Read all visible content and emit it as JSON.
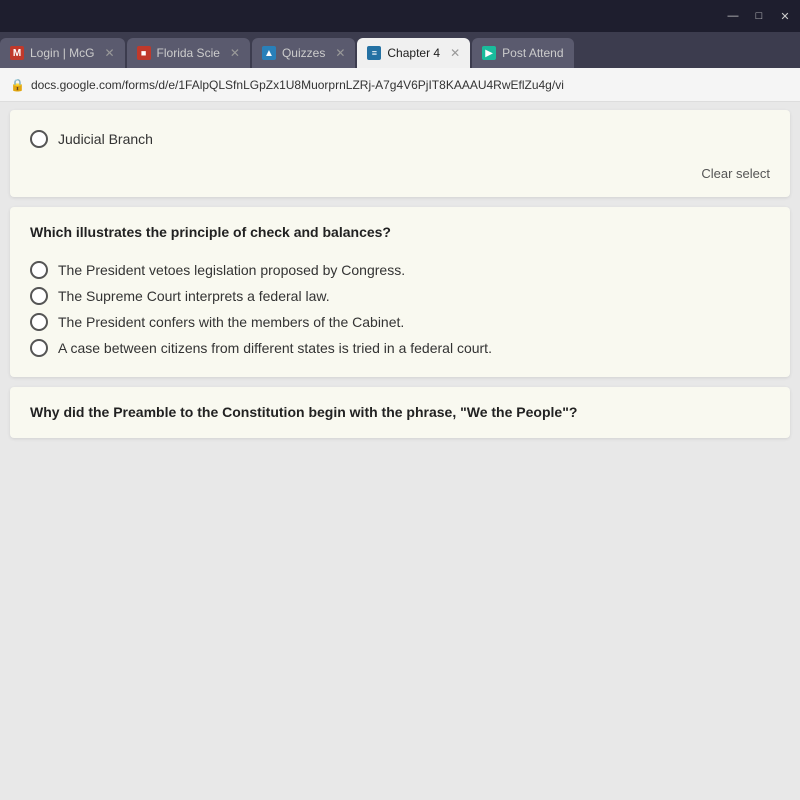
{
  "titlebar": {
    "minimize_label": "—",
    "restore_label": "□",
    "close_label": "✕"
  },
  "tabs": [
    {
      "id": "tab-mcg",
      "icon_type": "m",
      "icon_label": "M",
      "label": "Login | McG",
      "active": false,
      "closable": true
    },
    {
      "id": "tab-florida",
      "icon_type": "fl",
      "icon_label": "■",
      "label": "Florida Scie",
      "active": false,
      "closable": true
    },
    {
      "id": "tab-quizzes",
      "icon_type": "quiz",
      "icon_label": "▲",
      "label": "Quizzes",
      "active": false,
      "closable": true
    },
    {
      "id": "tab-chapter4",
      "icon_type": "chapter",
      "icon_label": "≡",
      "label": "Chapter 4",
      "active": true,
      "closable": true
    },
    {
      "id": "tab-post",
      "icon_type": "post",
      "icon_label": "▶",
      "label": "Post Attend",
      "active": false,
      "closable": false
    }
  ],
  "address_bar": {
    "url": "docs.google.com/forms/d/e/1FAlpQLSfnLGpZx1U8MuorprnLZRj-A7g4V6PjIT8KAAAU4RwEflZu4g/vi"
  },
  "first_card": {
    "option": "Judicial Branch",
    "clear_selection": "Clear select"
  },
  "second_card": {
    "question": "Which illustrates the principle of check and balances?",
    "options": [
      "The President vetoes legislation proposed by Congress.",
      "The Supreme Court interprets a federal law.",
      "The President confers with the members of the Cabinet.",
      "A case between citizens from different states is tried in a federal court."
    ]
  },
  "third_card": {
    "question": "Why did the Preamble to the Constitution begin with the phrase, \"We the People\"?"
  }
}
